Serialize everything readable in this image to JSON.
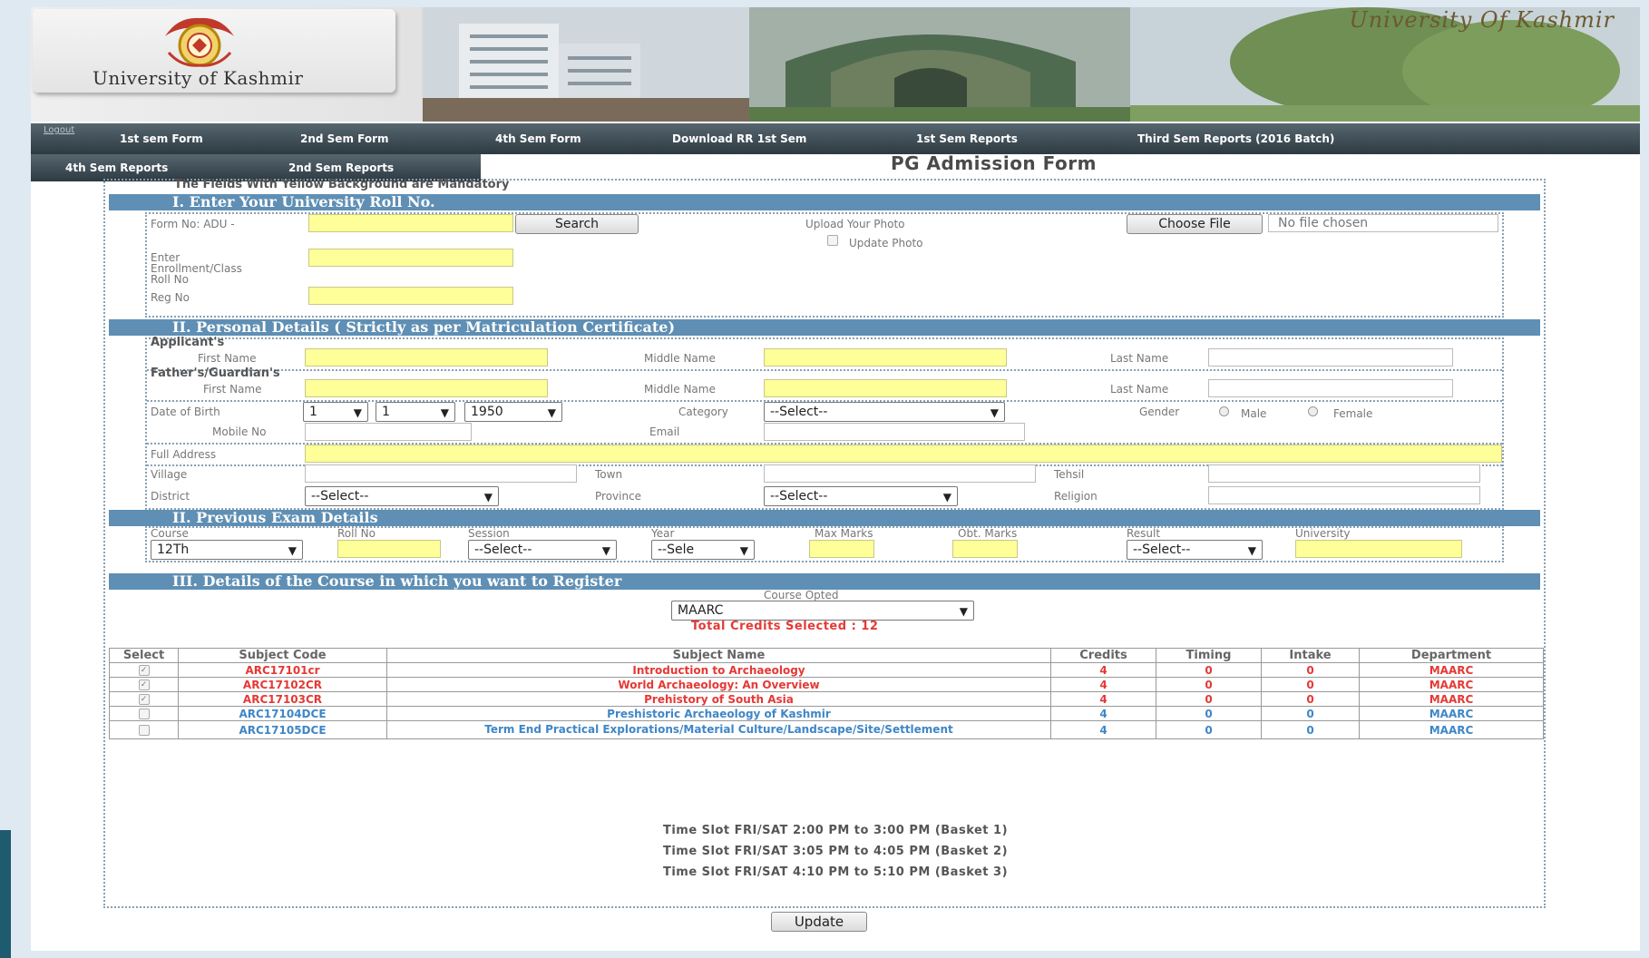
{
  "header": {
    "uni_name_left": "University of Kashmir",
    "uni_name_right": "University Of Kashmir"
  },
  "nav": {
    "logout": "Logout",
    "row1": [
      "1st sem Form",
      "2nd Sem Form",
      "4th Sem Form",
      "Download RR 1st Sem",
      "1st Sem Reports",
      "Third Sem Reports (2016 Batch)"
    ],
    "row2": [
      "4th Sem Reports",
      "2nd Sem Reports"
    ]
  },
  "form": {
    "title": "PG Admission Form",
    "mandatory_note": "The Fields With Yellow Background are Mandatory",
    "section1": {
      "heading": "I. Enter Your University Roll No.",
      "form_no_label": "Form No: ADU -",
      "search_button": "Search",
      "upload_photo_label": "Upload Your Photo",
      "choose_file_button": "Choose File",
      "no_file_text": "No file chosen",
      "update_photo_label": "Update Photo",
      "enrollment_label": "Enter Enrollment/Class Roll No",
      "reg_no_label": "Reg No"
    },
    "section2": {
      "heading": "II. Personal Details ( Strictly as per Matriculation Certificate)",
      "applicant_label": "Applicant's",
      "father_label": "Father's/Guardian's",
      "first_name": "First Name",
      "middle_name": "Middle Name",
      "last_name": "Last Name",
      "dob_label": "Date of Birth",
      "dob_day": "1",
      "dob_month": "1",
      "dob_year": "1950",
      "category_label": "Category",
      "category_value": "--Select--",
      "gender_label": "Gender",
      "male": "Male",
      "female": "Female",
      "mobile_label": "Mobile No",
      "email_label": "Email",
      "address_label": "Full Address",
      "village_label": "Village",
      "town_label": "Town",
      "tehsil_label": "Tehsil",
      "district_label": "District",
      "district_value": "--Select--",
      "province_label": "Province",
      "province_value": "--Select--",
      "religion_label": "Religion"
    },
    "section3": {
      "heading": "II. Previous Exam Details",
      "course_label": "Course",
      "course_value": "12Th",
      "roll_label": "Roll No",
      "session_label": "Session",
      "session_value": "--Select--",
      "year_label": "Year",
      "year_value": "--Sele",
      "max_marks_label": "Max Marks",
      "obt_marks_label": "Obt. Marks",
      "result_label": "Result",
      "result_value": "--Select--",
      "university_label": "University"
    },
    "section4": {
      "heading": "III. Details of the Course in which you want to Register",
      "course_opted_label": "Course Opted",
      "course_opted_value": "MAARC",
      "total_credits": "Total Credits Selected : 12"
    },
    "table": {
      "headers": [
        "Select",
        "Subject Code",
        "Subject Name",
        "Credits",
        "Timing",
        "Intake",
        "Department"
      ],
      "rows": [
        {
          "checked": true,
          "code": "ARC17101cr",
          "name": "Introduction to Archaeology",
          "credits": "4",
          "timing": "0",
          "intake": "0",
          "dept": "MAARC"
        },
        {
          "checked": true,
          "code": "ARC17102CR",
          "name": "World Archaeology: An Overview",
          "credits": "4",
          "timing": "0",
          "intake": "0",
          "dept": "MAARC"
        },
        {
          "checked": true,
          "code": "ARC17103CR",
          "name": "Prehistory of South Asia",
          "credits": "4",
          "timing": "0",
          "intake": "0",
          "dept": "MAARC"
        },
        {
          "checked": false,
          "code": "ARC17104DCE",
          "name": "Preshistoric Archaeology of Kashmir",
          "credits": "4",
          "timing": "0",
          "intake": "0",
          "dept": "MAARC"
        },
        {
          "checked": false,
          "code": "ARC17105DCE",
          "name": "Term End Practical Explorations/Material Culture/Landscape/Site/Settlement",
          "credits": "4",
          "timing": "0",
          "intake": "0",
          "dept": "MAARC"
        }
      ]
    },
    "time_slots": [
      "Time Slot FRI/SAT 2:00 PM to 3:00 PM (Basket 1)",
      "Time Slot FRI/SAT 3:05 PM to 4:05 PM (Basket 2)",
      "Time Slot FRI/SAT 4:10 PM to 5:10 PM (Basket 3)"
    ],
    "update_button": "Update"
  }
}
